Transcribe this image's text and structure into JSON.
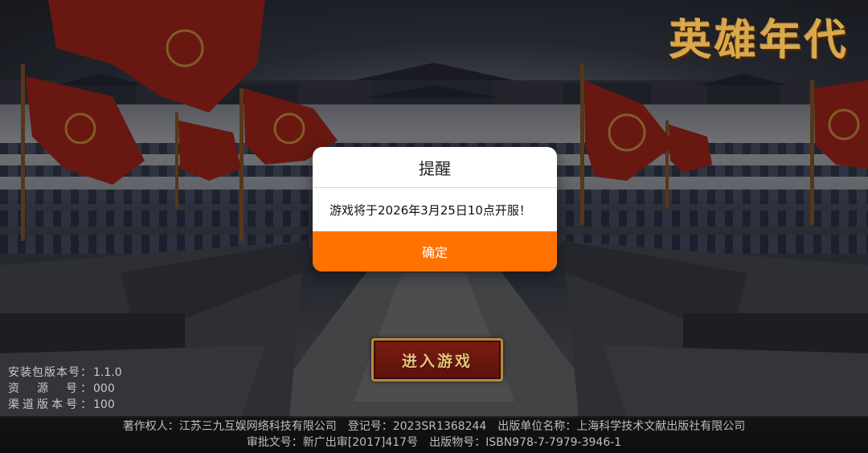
{
  "logo": {
    "text": "英雄年代"
  },
  "dialog": {
    "title": "提醒",
    "message": "游戏将于2026年3月25日10点开服！",
    "confirm_label": "确定"
  },
  "enter_game_button": {
    "label": "进入游戏"
  },
  "version_info": [
    {
      "key": "安装包版本号：",
      "value": "1.1.0"
    },
    {
      "key": "资　源　号：",
      "value": "000"
    },
    {
      "key": "渠道版本号：",
      "value": "100"
    }
  ],
  "footer": {
    "line1": "著作权人：江苏三九互娱网络科技有限公司　登记号：2023SR1368244　出版单位名称：上海科学技术文献出版社有限公司",
    "line2": "审批文号：新广出审[2017]417号　出版物号：ISBN978-7-7979-3946-1"
  },
  "colors": {
    "accent": "#ff7200",
    "dialog_bg": "#ffffff",
    "button_red": "#7a1c12",
    "gold": "#d9a94a"
  }
}
